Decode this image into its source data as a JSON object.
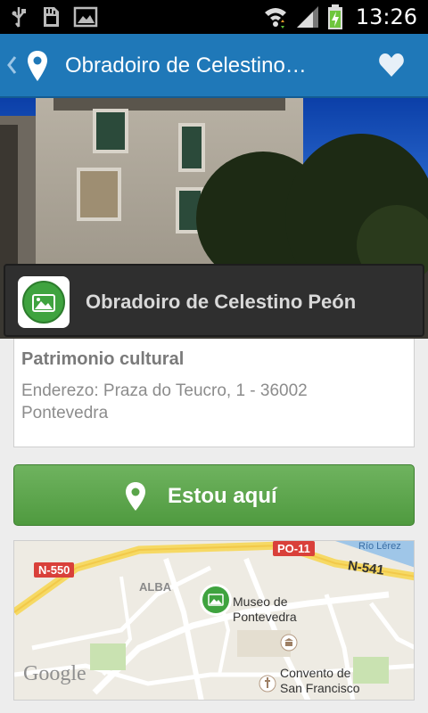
{
  "status_bar": {
    "time": "13:26",
    "icons": [
      "usb-icon",
      "sd-card-icon",
      "image-icon",
      "wifi-icon",
      "signal-icon",
      "battery-charging-icon"
    ]
  },
  "action_bar": {
    "title": "Obradoiro de Celestino…",
    "back_icon": "chevron-left-icon",
    "pin_icon": "map-pin-icon",
    "favorite_icon": "heart-icon",
    "color": "#1f78b8"
  },
  "place": {
    "name": "Obradoiro de Celestino Peón",
    "category": "Patrimonio cultural",
    "address": "Enderezo: Praza do Teucro, 1 - 36002 Pontevedra"
  },
  "checkin_button": {
    "label": "Estou aquí",
    "color": "#5aa54a"
  },
  "map": {
    "labels": {
      "road_n550": "N-550",
      "road_po11": "PO-11",
      "road_n541": "N-541",
      "hio_lerez": "Río Lérez",
      "alba": "ALBA",
      "museo": "Museo de\nPontevedra",
      "convento": "Convento de\nSan Francisco",
      "google": "Google"
    }
  }
}
